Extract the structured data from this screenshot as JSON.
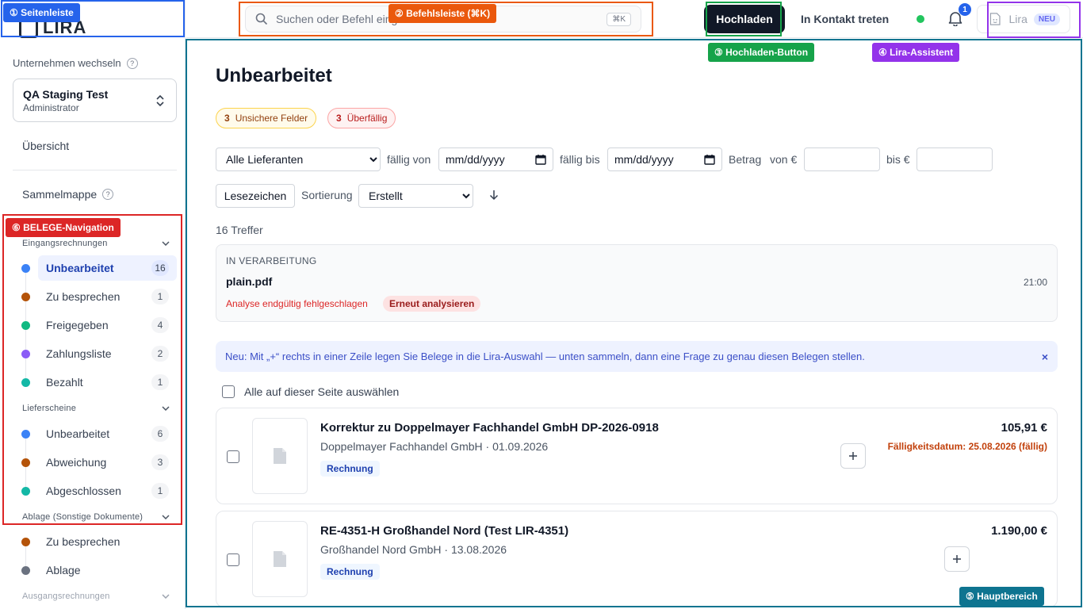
{
  "sidebar": {
    "logo_text": "LIRA",
    "company_switch_label": "Unternehmen wechseln",
    "help_glyph": "?",
    "company": {
      "name": "QA Staging Test",
      "role": "Administrator"
    },
    "overview": "Übersicht",
    "collection": "Sammelmappe",
    "groups": {
      "incoming": "Eingangsrechnungen",
      "delivery": "Lieferscheine",
      "archive": "Ablage (Sonstige Dokumente)",
      "outgoing": "Ausgangsrechnungen"
    },
    "incoming_items": [
      {
        "label": "Unbearbeitet",
        "count": "16",
        "color": "#3b82f6"
      },
      {
        "label": "Zu besprechen",
        "count": "1",
        "color": "#b45309"
      },
      {
        "label": "Freigegeben",
        "count": "4",
        "color": "#10b981"
      },
      {
        "label": "Zahlungsliste",
        "count": "2",
        "color": "#8b5cf6"
      },
      {
        "label": "Bezahlt",
        "count": "1",
        "color": "#14b8a6"
      }
    ],
    "delivery_items": [
      {
        "label": "Unbearbeitet",
        "count": "6",
        "color": "#3b82f6"
      },
      {
        "label": "Abweichung",
        "count": "3",
        "color": "#b45309"
      },
      {
        "label": "Abgeschlossen",
        "count": "1",
        "color": "#14b8a6"
      }
    ],
    "archive_items": [
      {
        "label": "Zu besprechen",
        "color": "#b45309"
      },
      {
        "label": "Ablage",
        "color": "#6b7280"
      }
    ]
  },
  "topbar": {
    "search_placeholder": "Suchen oder Befehl eingeben",
    "search_shortcut": "⌘K",
    "upload": "Hochladen",
    "contact": "In Kontakt treten",
    "notification_count": "1",
    "lira": "Lira",
    "lira_badge": "NEU"
  },
  "main": {
    "title": "Unbearbeitet",
    "chips": [
      {
        "count": "3",
        "label": "Unsichere Felder"
      },
      {
        "count": "3",
        "label": "Überfällig"
      }
    ],
    "filters": {
      "supplier": "Alle Lieferanten",
      "due_from_label": "fällig von",
      "due_to_label": "fällig bis",
      "date_placeholder": "mm/dd/yyyy",
      "amount_label": "Betrag",
      "amount_from_label": "von €",
      "amount_to_label": "bis €",
      "bookmarks": "Lesezeichen",
      "sort_label": "Sortierung",
      "sort_value": "Erstellt"
    },
    "hits": "16 Treffer",
    "processing": {
      "label": "IN VERARBEITUNG",
      "file": "plain.pdf",
      "time": "21:00",
      "error": "Analyse endgültig fehlgeschlagen",
      "retry": "Erneut analysieren"
    },
    "hint": "Neu: Mit „+“ rechts in einer Zeile legen Sie Belege in die Lira-Auswahl — unten sammeln, dann eine Frage zu genau diesen Belegen stellen.",
    "hint_close": "×",
    "select_all": "Alle auf dieser Seite auswählen",
    "documents": [
      {
        "title": "Korrektur zu Doppelmayer Fachhandel GmbH DP-2026-0918",
        "meta": "Doppelmayer Fachhandel GmbH · 01.09.2026",
        "tag": "Rechnung",
        "amount": "105,91 €",
        "due": "Fälligkeitsdatum: 25.08.2026 (fällig)"
      },
      {
        "title": "RE-4351-H Großhandel Nord (Test LIR-4351)",
        "meta": "Großhandel Nord GmbH · 13.08.2026",
        "tag": "Rechnung",
        "amount": "1.190,00 €",
        "due": ""
      }
    ]
  },
  "overlays": [
    {
      "label": "① Seitenleiste",
      "color": "#2563eb"
    },
    {
      "label": "② Befehlsleiste (⌘K)",
      "color": "#ea580c"
    },
    {
      "label": "③ Hochladen-Button",
      "color": "#16a34a"
    },
    {
      "label": "④ Lira-Assistent",
      "color": "#9333ea"
    },
    {
      "label": "⑤ Hauptbereich",
      "color": "#0e7490"
    },
    {
      "label": "⑥ BELEGE-Navigation",
      "color": "#dc2626"
    }
  ]
}
